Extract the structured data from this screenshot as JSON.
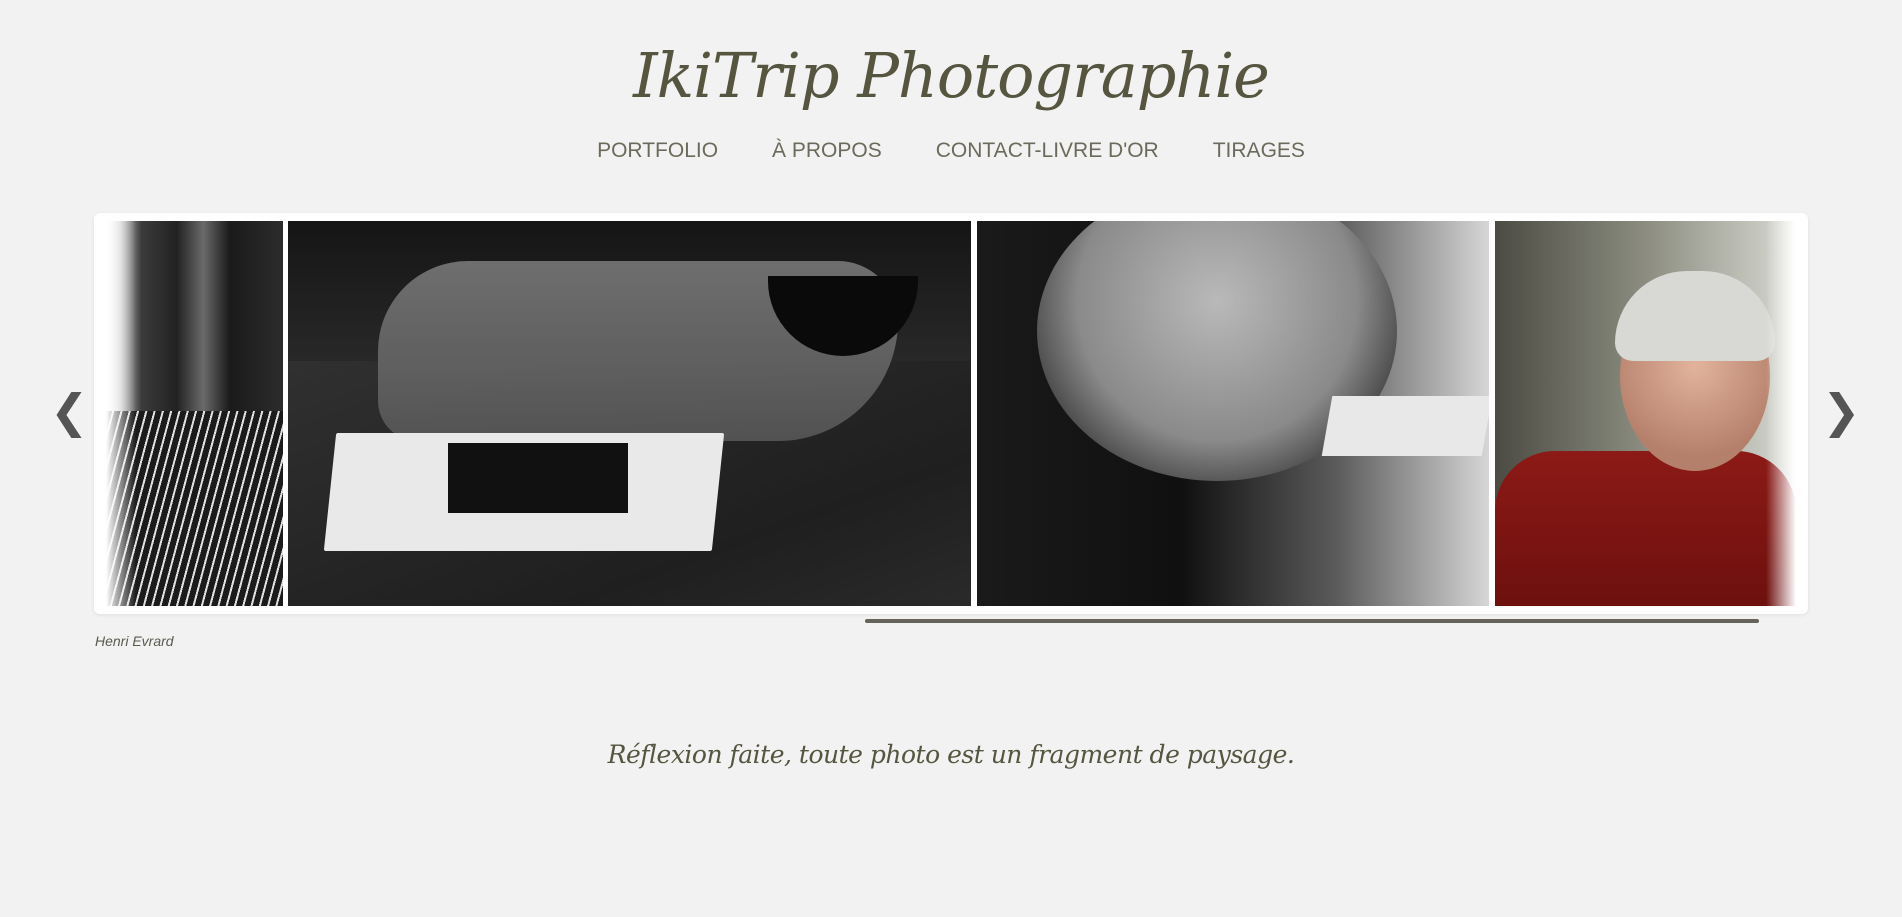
{
  "header": {
    "site_title": "IkiTrip Photographie"
  },
  "nav": {
    "items": [
      {
        "label": "PORTFOLIO"
      },
      {
        "label": "À PROPOS"
      },
      {
        "label": "CONTACT-LIVRE D'OR"
      },
      {
        "label": "TIRAGES"
      }
    ]
  },
  "slider": {
    "prev_icon": "chevron-left-icon",
    "next_icon": "chevron-right-icon",
    "prev_glyph": "❮",
    "next_glyph": "❯",
    "caption": "Henri Evrard",
    "progress_fraction": 0.52
  },
  "footer": {
    "quote": "Réflexion faite, toute photo est un fragment de paysage."
  },
  "colors": {
    "background": "#f2f2f2",
    "title": "#56553f",
    "nav": "#6c6a5a",
    "progress_bar": "#65635a"
  }
}
